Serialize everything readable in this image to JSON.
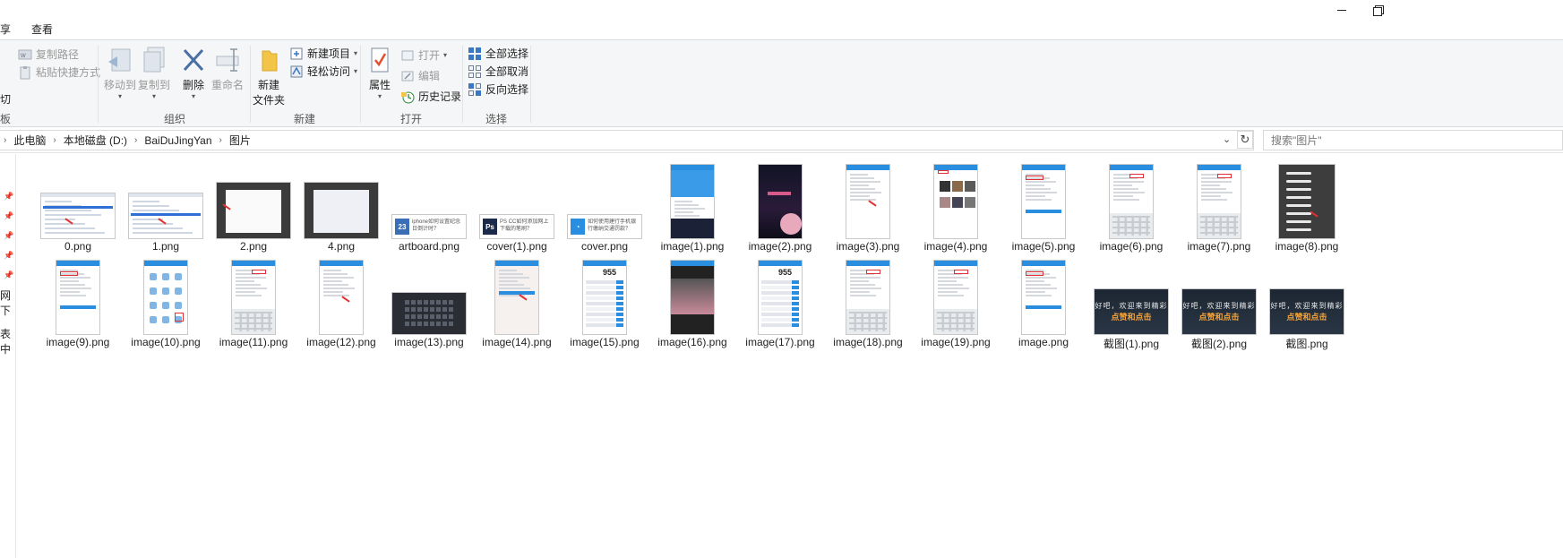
{
  "tabs": [
    "享",
    "查看"
  ],
  "window": {
    "minimize_icon": "minimize-icon",
    "restore_icon": "restore-icon"
  },
  "ribbon": {
    "clipboard": {
      "copy_path": "复制路径",
      "paste_shortcut": "粘贴快捷方式",
      "cut_fragment": "切",
      "group_fragment": "板"
    },
    "organize": {
      "label": "组织",
      "move_to": "移动到",
      "copy_to": "复制到",
      "delete": "删除",
      "rename": "重命名"
    },
    "new": {
      "label": "新建",
      "new_folder_line1": "新建",
      "new_folder_line2": "文件夹",
      "new_item": "新建项目",
      "easy_access": "轻松访问"
    },
    "open": {
      "label": "打开",
      "properties": "属性",
      "open": "打开",
      "edit": "编辑",
      "history": "历史记录"
    },
    "select": {
      "label": "选择",
      "select_all": "全部选择",
      "select_none": "全部取消",
      "invert": "反向选择"
    }
  },
  "address": {
    "crumbs": [
      "此电脑",
      "本地磁盘 (D:)",
      "BaiDuJingYan",
      "图片"
    ],
    "search_placeholder": "搜索\"图片\""
  },
  "nav_fragments": [
    "网下",
    "表中"
  ],
  "files": [
    {
      "name": "0.png",
      "kind": "land"
    },
    {
      "name": "1.png",
      "kind": "land"
    },
    {
      "name": "2.png",
      "kind": "dark"
    },
    {
      "name": "4.png",
      "kind": "dark-map"
    },
    {
      "name": "artboard.png",
      "kind": "banner",
      "icon_text": "23",
      "icon_color": "#3a6fb8",
      "text": "iphone如何设置纪念日倒计时？"
    },
    {
      "name": "cover(1).png",
      "kind": "banner",
      "icon_text": "Ps",
      "icon_color": "#1b2a4a",
      "text": "PS CC如何添加网上下载的笔刷？"
    },
    {
      "name": "cover.png",
      "kind": "banner",
      "icon_text": "◔",
      "icon_color": "#2a8ee0",
      "text": "如何使用建行手机银行缴纳交通罚款？"
    },
    {
      "name": "image(1).png",
      "kind": "phone-blue"
    },
    {
      "name": "image(2).png",
      "kind": "night"
    },
    {
      "name": "image(3).png",
      "kind": "phone"
    },
    {
      "name": "image(4).png",
      "kind": "phone-shop"
    },
    {
      "name": "image(5).png",
      "kind": "phone-form"
    },
    {
      "name": "image(6).png",
      "kind": "phone-kb"
    },
    {
      "name": "image(7).png",
      "kind": "phone-kb"
    },
    {
      "name": "image(8).png",
      "kind": "dark-panel"
    },
    {
      "name": "image(9).png",
      "kind": "phone-form"
    },
    {
      "name": "image(10).png",
      "kind": "phone-grid"
    },
    {
      "name": "image(11).png",
      "kind": "phone-kb"
    },
    {
      "name": "image(12).png",
      "kind": "phone"
    },
    {
      "name": "image(13).png",
      "kind": "screen"
    },
    {
      "name": "image(14).png",
      "kind": "phone-btn"
    },
    {
      "name": "image(15).png",
      "kind": "phone-955"
    },
    {
      "name": "image(16).png",
      "kind": "phone-dark"
    },
    {
      "name": "image(17).png",
      "kind": "phone-955"
    },
    {
      "name": "image(18).png",
      "kind": "phone-kb"
    },
    {
      "name": "image(19).png",
      "kind": "phone-kb"
    },
    {
      "name": "image.png",
      "kind": "phone-form"
    },
    {
      "name": "截图(1).png",
      "kind": "redtitle"
    },
    {
      "name": "截图(2).png",
      "kind": "redtitle"
    },
    {
      "name": "截图.png",
      "kind": "redtitle"
    }
  ],
  "banner_text": {
    "l1": "好吧，欢迎来到精彩",
    "l2": "点赞和点击"
  },
  "big_number": "955",
  "colors": {
    "accent": "#2a8ee0",
    "ribbon_bg": "#f5f6f7",
    "red_mark": "#e23030"
  }
}
